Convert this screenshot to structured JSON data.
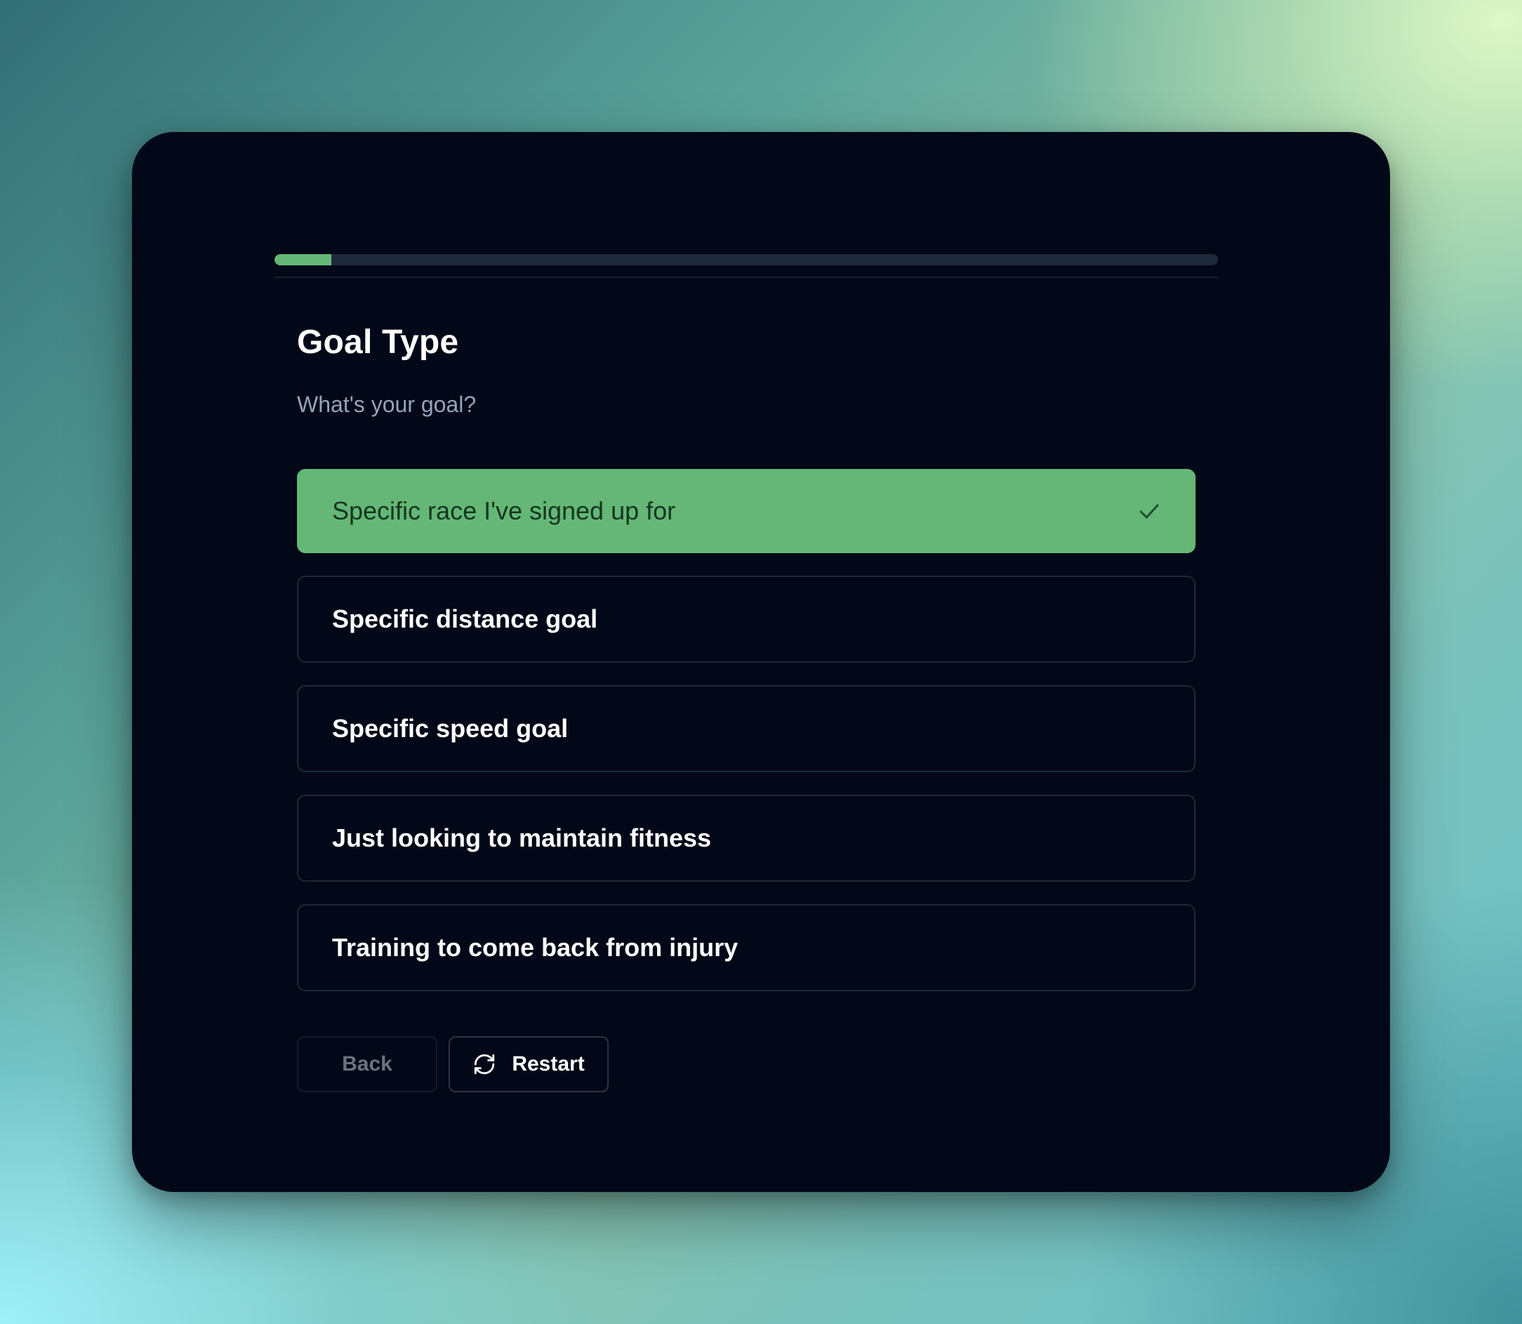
{
  "progress": {
    "fraction": 0.06,
    "fill_color": "#64b777",
    "track_color": "#1e293b"
  },
  "step": {
    "title": "Goal Type",
    "question": "What's your goal?"
  },
  "options": [
    {
      "label": "Specific race I've signed up for",
      "selected": true
    },
    {
      "label": "Specific distance goal",
      "selected": false
    },
    {
      "label": "Specific speed goal",
      "selected": false
    },
    {
      "label": "Just looking to maintain fitness",
      "selected": false
    },
    {
      "label": "Training to come back from injury",
      "selected": false
    }
  ],
  "selected_icon": "check-icon",
  "buttons": {
    "back_label": "Back",
    "restart_label": "Restart",
    "restart_icon": "refresh-icon"
  },
  "colors": {
    "card_bg": "#020817",
    "accent": "#64b777",
    "border": "#1e293b"
  }
}
